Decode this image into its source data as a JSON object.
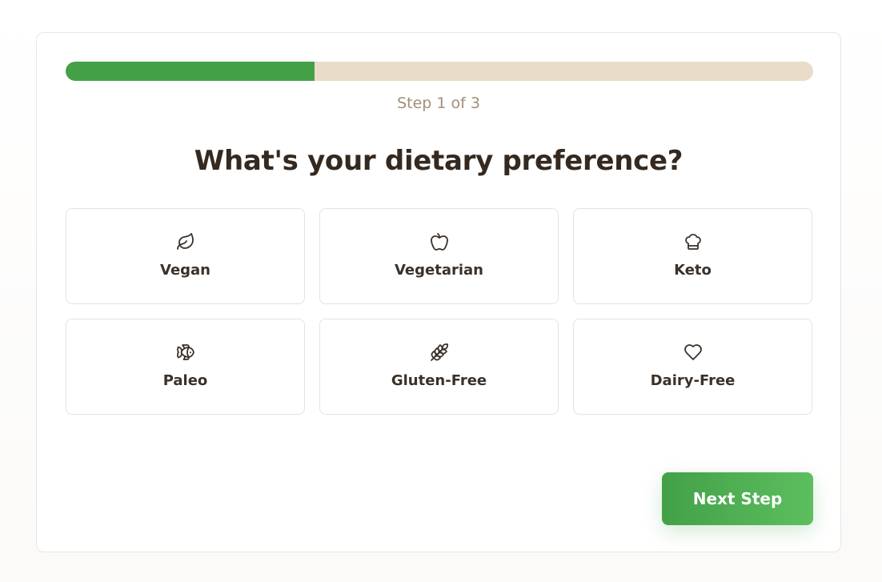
{
  "progress": {
    "fraction": 0.333,
    "fill_color": "#43a047",
    "track_color": "#e9dcc8",
    "step_text": "Step 1 of 3"
  },
  "question": "What's your dietary preference?",
  "options": [
    {
      "label": "Vegan",
      "icon": "leaf-icon"
    },
    {
      "label": "Vegetarian",
      "icon": "apple-icon"
    },
    {
      "label": "Keto",
      "icon": "chef-hat-icon"
    },
    {
      "label": "Paleo",
      "icon": "fish-icon"
    },
    {
      "label": "Gluten-Free",
      "icon": "wheat-icon"
    },
    {
      "label": "Dairy-Free",
      "icon": "heart-icon"
    }
  ],
  "next_button": {
    "label": "Next Step",
    "color": "#43a047"
  }
}
